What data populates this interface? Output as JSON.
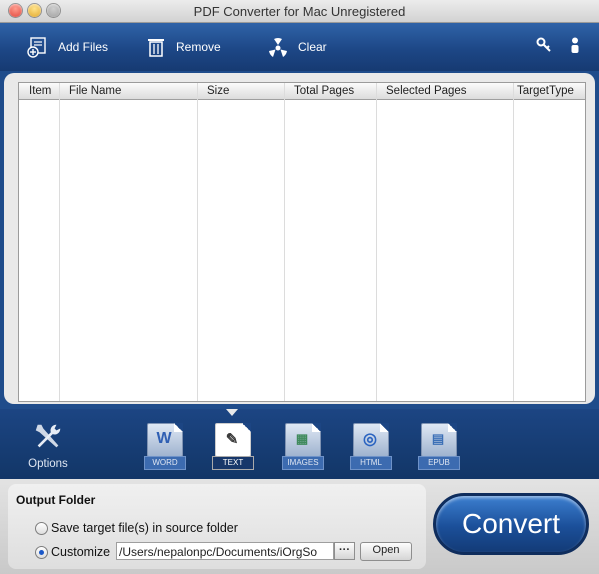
{
  "window": {
    "title": "PDF Converter for Mac Unregistered"
  },
  "toolbar": {
    "add_files": "Add Files",
    "remove": "Remove",
    "clear": "Clear",
    "icons": {
      "add_files": "add-files-icon",
      "remove": "trash-icon",
      "clear": "clear-icon",
      "register": "key-icon",
      "account": "user-icon"
    }
  },
  "table": {
    "columns": [
      "Item",
      "File Name",
      "Size",
      "Total Pages",
      "Selected Pages",
      "TargetType"
    ],
    "rows": []
  },
  "output_types": {
    "options_label": "Options",
    "types": [
      {
        "label": "WORD"
      },
      {
        "label": "TEXT",
        "selected": true
      },
      {
        "label": "IMAGES"
      },
      {
        "label": "HTML"
      },
      {
        "label": "EPUB"
      }
    ]
  },
  "output": {
    "title": "Output Folder",
    "radio_source": "Save target file(s) in source folder",
    "radio_customize": "Customize",
    "selected": "customize",
    "path": "/Users/nepalonpc/Documents/iOrgSo",
    "browse_label": "···",
    "open_label": "Open"
  },
  "convert_label": "Convert",
  "colors": {
    "toolbar_blue": "#1d4786",
    "panel_bg": "#e9e9e9",
    "selected_radio": "#1b58c8"
  }
}
